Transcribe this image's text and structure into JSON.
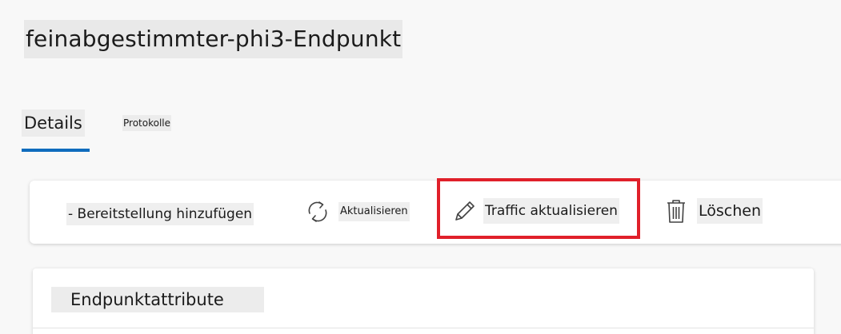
{
  "page": {
    "title": "feinabgestimmter-phi3-Endpunkt"
  },
  "tabs": [
    {
      "label": "Details",
      "selected": true
    },
    {
      "label": "Protokolle",
      "selected": false
    }
  ],
  "toolbar": {
    "add_deployment_label": "- Bereitstellung hinzufügen",
    "refresh_label": "Aktualisieren",
    "update_traffic_label": "Traffic aktualisieren",
    "delete_label": "Löschen"
  },
  "card": {
    "title": "Endpunktattribute"
  },
  "colors": {
    "accent": "#0f6cbd",
    "highlight": "#e0202a"
  }
}
